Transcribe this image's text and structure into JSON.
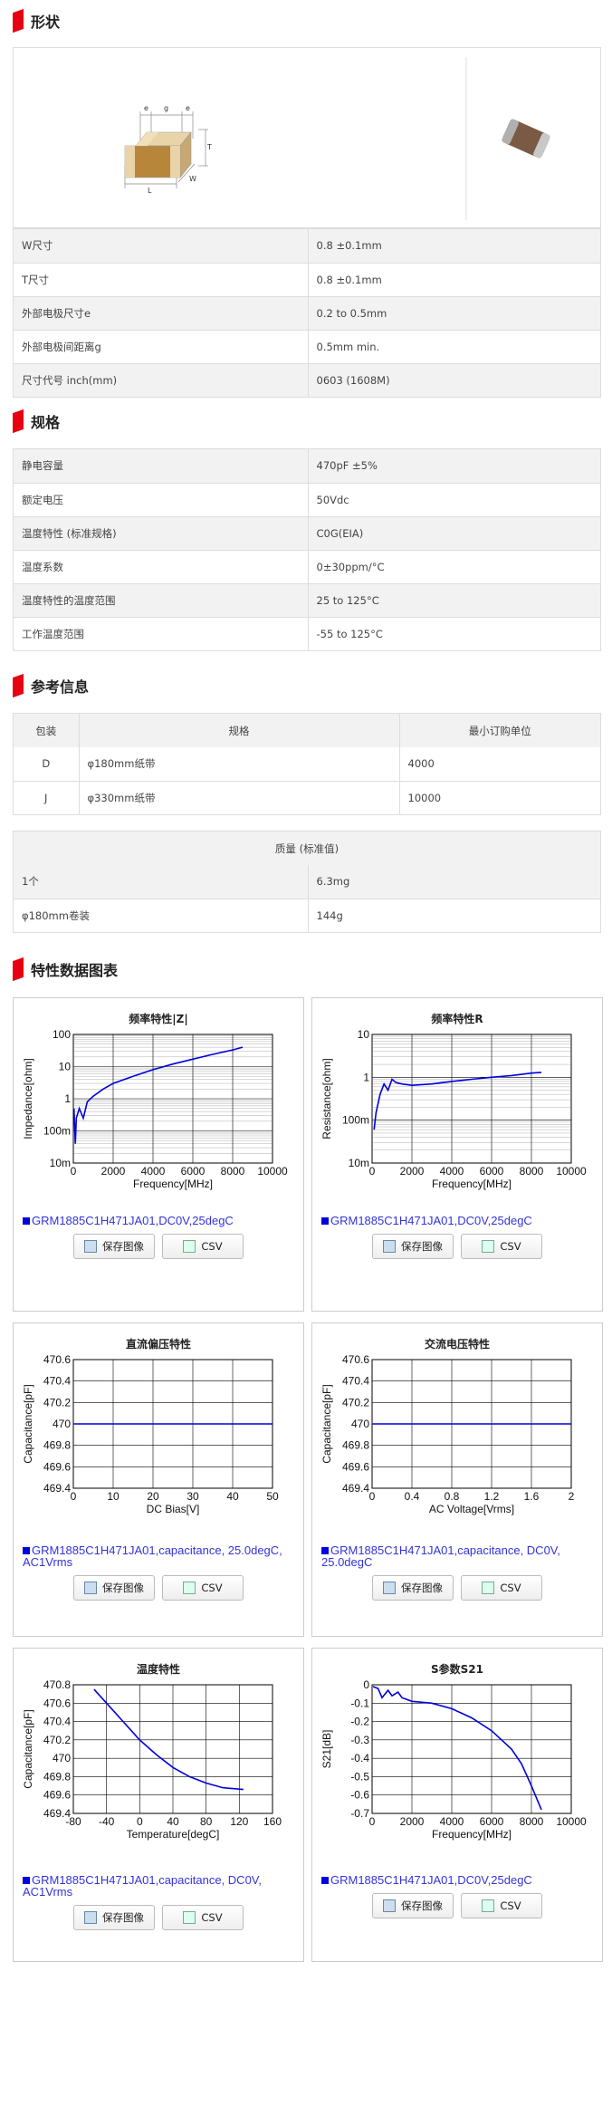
{
  "sections": {
    "shape": "形状",
    "spec": "规格",
    "ref": "参考信息",
    "charts": "特性数据图表"
  },
  "shape_dims": {
    "e": "e",
    "g": "g",
    "T": "T",
    "L": "L",
    "W": "W"
  },
  "shape_rows": [
    {
      "k": "W尺寸",
      "v": "0.8 ±0.1mm"
    },
    {
      "k": "T尺寸",
      "v": "0.8 ±0.1mm"
    },
    {
      "k": "外部电极尺寸e",
      "v": "0.2 to 0.5mm"
    },
    {
      "k": "外部电极间距离g",
      "v": "0.5mm min."
    },
    {
      "k": "尺寸代号 inch(mm)",
      "v": "0603 (1608M)"
    }
  ],
  "spec_rows": [
    {
      "k": "静电容量",
      "v": "470pF ±5%"
    },
    {
      "k": "额定电压",
      "v": "50Vdc"
    },
    {
      "k": "温度特性 (标准规格)",
      "v": "C0G(EIA)"
    },
    {
      "k": "温度系数",
      "v": "0±30ppm/°C"
    },
    {
      "k": "温度特性的温度范围",
      "v": "25 to 125°C"
    },
    {
      "k": "工作温度范围",
      "v": "-55 to 125°C"
    }
  ],
  "pack_head": {
    "c1": "包装",
    "c2": "规格",
    "c3": "最小订购单位"
  },
  "pack_rows": [
    {
      "c1": "D",
      "c2": "φ180mm纸带",
      "c3": "4000"
    },
    {
      "c1": "J",
      "c2": "φ330mm纸带",
      "c3": "10000"
    }
  ],
  "mass_head": "质量 (标准值)",
  "mass_rows": [
    {
      "k": "1个",
      "v": "6.3mg"
    },
    {
      "k": "φ180mm卷装",
      "v": "144g"
    }
  ],
  "buttons": {
    "save": "保存图像",
    "csv": "CSV"
  },
  "accent": "#e60012",
  "chart_data": [
    {
      "type": "line",
      "title": "频率特性|Z|",
      "xlabel": "Frequency[MHz]",
      "ylabel": "Impedance[ohm]",
      "xticks": [
        "0",
        "2000",
        "4000",
        "6000",
        "8000",
        "10000"
      ],
      "yticks": [
        "100",
        "10",
        "1",
        "100m",
        "10m"
      ],
      "ylog": true,
      "ylim": [
        0.01,
        100
      ],
      "xlim": [
        0,
        10000
      ],
      "series": [
        {
          "name": "GRM1885C1H471JA01,DC0V,25degC",
          "x": [
            30,
            100,
            150,
            300,
            500,
            700,
            1000,
            1500,
            2000,
            3000,
            4000,
            5000,
            6000,
            7000,
            8000,
            8500
          ],
          "y": [
            0.5,
            0.04,
            0.25,
            0.5,
            0.25,
            0.8,
            1.2,
            2,
            3,
            5,
            8,
            12,
            17,
            24,
            33,
            40
          ]
        }
      ],
      "legend": "GRM1885C1H471JA01,DC0V,25degC"
    },
    {
      "type": "line",
      "title": "频率特性R",
      "xlabel": "Frequency[MHz]",
      "ylabel": "Resistance[ohm]",
      "xticks": [
        "0",
        "2000",
        "4000",
        "6000",
        "8000",
        "10000"
      ],
      "yticks": [
        "10",
        "1",
        "100m",
        "10m"
      ],
      "ylog": true,
      "ylim": [
        0.01,
        10
      ],
      "xlim": [
        0,
        10000
      ],
      "series": [
        {
          "name": "GRM1885C1H471JA01,DC0V,25degC",
          "x": [
            100,
            200,
            400,
            600,
            800,
            1000,
            1200,
            1500,
            2000,
            3000,
            4000,
            5000,
            6000,
            7000,
            8000,
            8500
          ],
          "y": [
            0.06,
            0.15,
            0.4,
            0.7,
            0.5,
            0.9,
            0.75,
            0.7,
            0.65,
            0.7,
            0.8,
            0.9,
            1.0,
            1.1,
            1.25,
            1.3
          ]
        }
      ],
      "legend": "GRM1885C1H471JA01,DC0V,25degC"
    },
    {
      "type": "line",
      "title": "直流偏压特性",
      "xlabel": "DC Bias[V]",
      "ylabel": "Capacitance[pF]",
      "xticks": [
        "0",
        "10",
        "20",
        "30",
        "40",
        "50"
      ],
      "yticks": [
        "470.6",
        "470.4",
        "470.2",
        "470",
        "469.8",
        "469.6",
        "469.4"
      ],
      "ylim": [
        469.4,
        470.6
      ],
      "xlim": [
        0,
        50
      ],
      "series": [
        {
          "name": "GRM1885C1H471JA01,capacitance, 25.0degC, AC1Vrms",
          "x": [
            0,
            50
          ],
          "y": [
            470,
            470
          ]
        }
      ],
      "legend": "GRM1885C1H471JA01,capacitance, 25.0degC, AC1Vrms"
    },
    {
      "type": "line",
      "title": "交流电压特性",
      "xlabel": "AC Voltage[Vrms]",
      "ylabel": "Capacitance[pF]",
      "xticks": [
        "0",
        "0.4",
        "0.8",
        "1.2",
        "1.6",
        "2"
      ],
      "yticks": [
        "470.6",
        "470.4",
        "470.2",
        "470",
        "469.8",
        "469.6",
        "469.4"
      ],
      "ylim": [
        469.4,
        470.6
      ],
      "xlim": [
        0,
        2
      ],
      "series": [
        {
          "name": "GRM1885C1H471JA01,capacitance, DC0V, 25.0degC",
          "x": [
            0,
            2
          ],
          "y": [
            470,
            470
          ]
        }
      ],
      "legend": "GRM1885C1H471JA01,capacitance, DC0V, 25.0degC"
    },
    {
      "type": "line",
      "title": "温度特性",
      "xlabel": "Temperature[degC]",
      "ylabel": "Capacitance[pF]",
      "xticks": [
        "-80",
        "-40",
        "0",
        "40",
        "80",
        "120",
        "160"
      ],
      "yticks": [
        "470.8",
        "470.6",
        "470.4",
        "470.2",
        "470",
        "469.8",
        "469.6",
        "469.4"
      ],
      "ylim": [
        469.4,
        470.8
      ],
      "xlim": [
        -80,
        160
      ],
      "series": [
        {
          "name": "GRM1885C1H471JA01,capacitance, DC0V, AC1Vrms",
          "x": [
            -55,
            -40,
            -20,
            0,
            20,
            40,
            60,
            80,
            100,
            125
          ],
          "y": [
            470.75,
            470.6,
            470.4,
            470.2,
            470.04,
            469.9,
            469.8,
            469.73,
            469.68,
            469.66
          ]
        }
      ],
      "legend": "GRM1885C1H471JA01,capacitance, DC0V, AC1Vrms"
    },
    {
      "type": "line",
      "title": "S参数S21",
      "xlabel": "Frequency[MHz]",
      "ylabel": "S21[dB]",
      "xticks": [
        "0",
        "2000",
        "4000",
        "6000",
        "8000",
        "10000"
      ],
      "yticks": [
        "0",
        "-0.1",
        "-0.2",
        "-0.3",
        "-0.4",
        "-0.5",
        "-0.6",
        "-0.7"
      ],
      "ylim": [
        -0.7,
        0
      ],
      "xlim": [
        0,
        10000
      ],
      "series": [
        {
          "name": "GRM1885C1H471JA01,DC0V,25degC",
          "x": [
            50,
            300,
            500,
            800,
            1000,
            1300,
            1500,
            2000,
            3000,
            4000,
            5000,
            6000,
            7000,
            7500,
            8000,
            8500
          ],
          "y": [
            -0.01,
            -0.02,
            -0.07,
            -0.03,
            -0.06,
            -0.04,
            -0.07,
            -0.09,
            -0.1,
            -0.13,
            -0.18,
            -0.25,
            -0.35,
            -0.43,
            -0.55,
            -0.68
          ]
        }
      ],
      "legend": "GRM1885C1H471JA01,DC0V,25degC"
    }
  ]
}
